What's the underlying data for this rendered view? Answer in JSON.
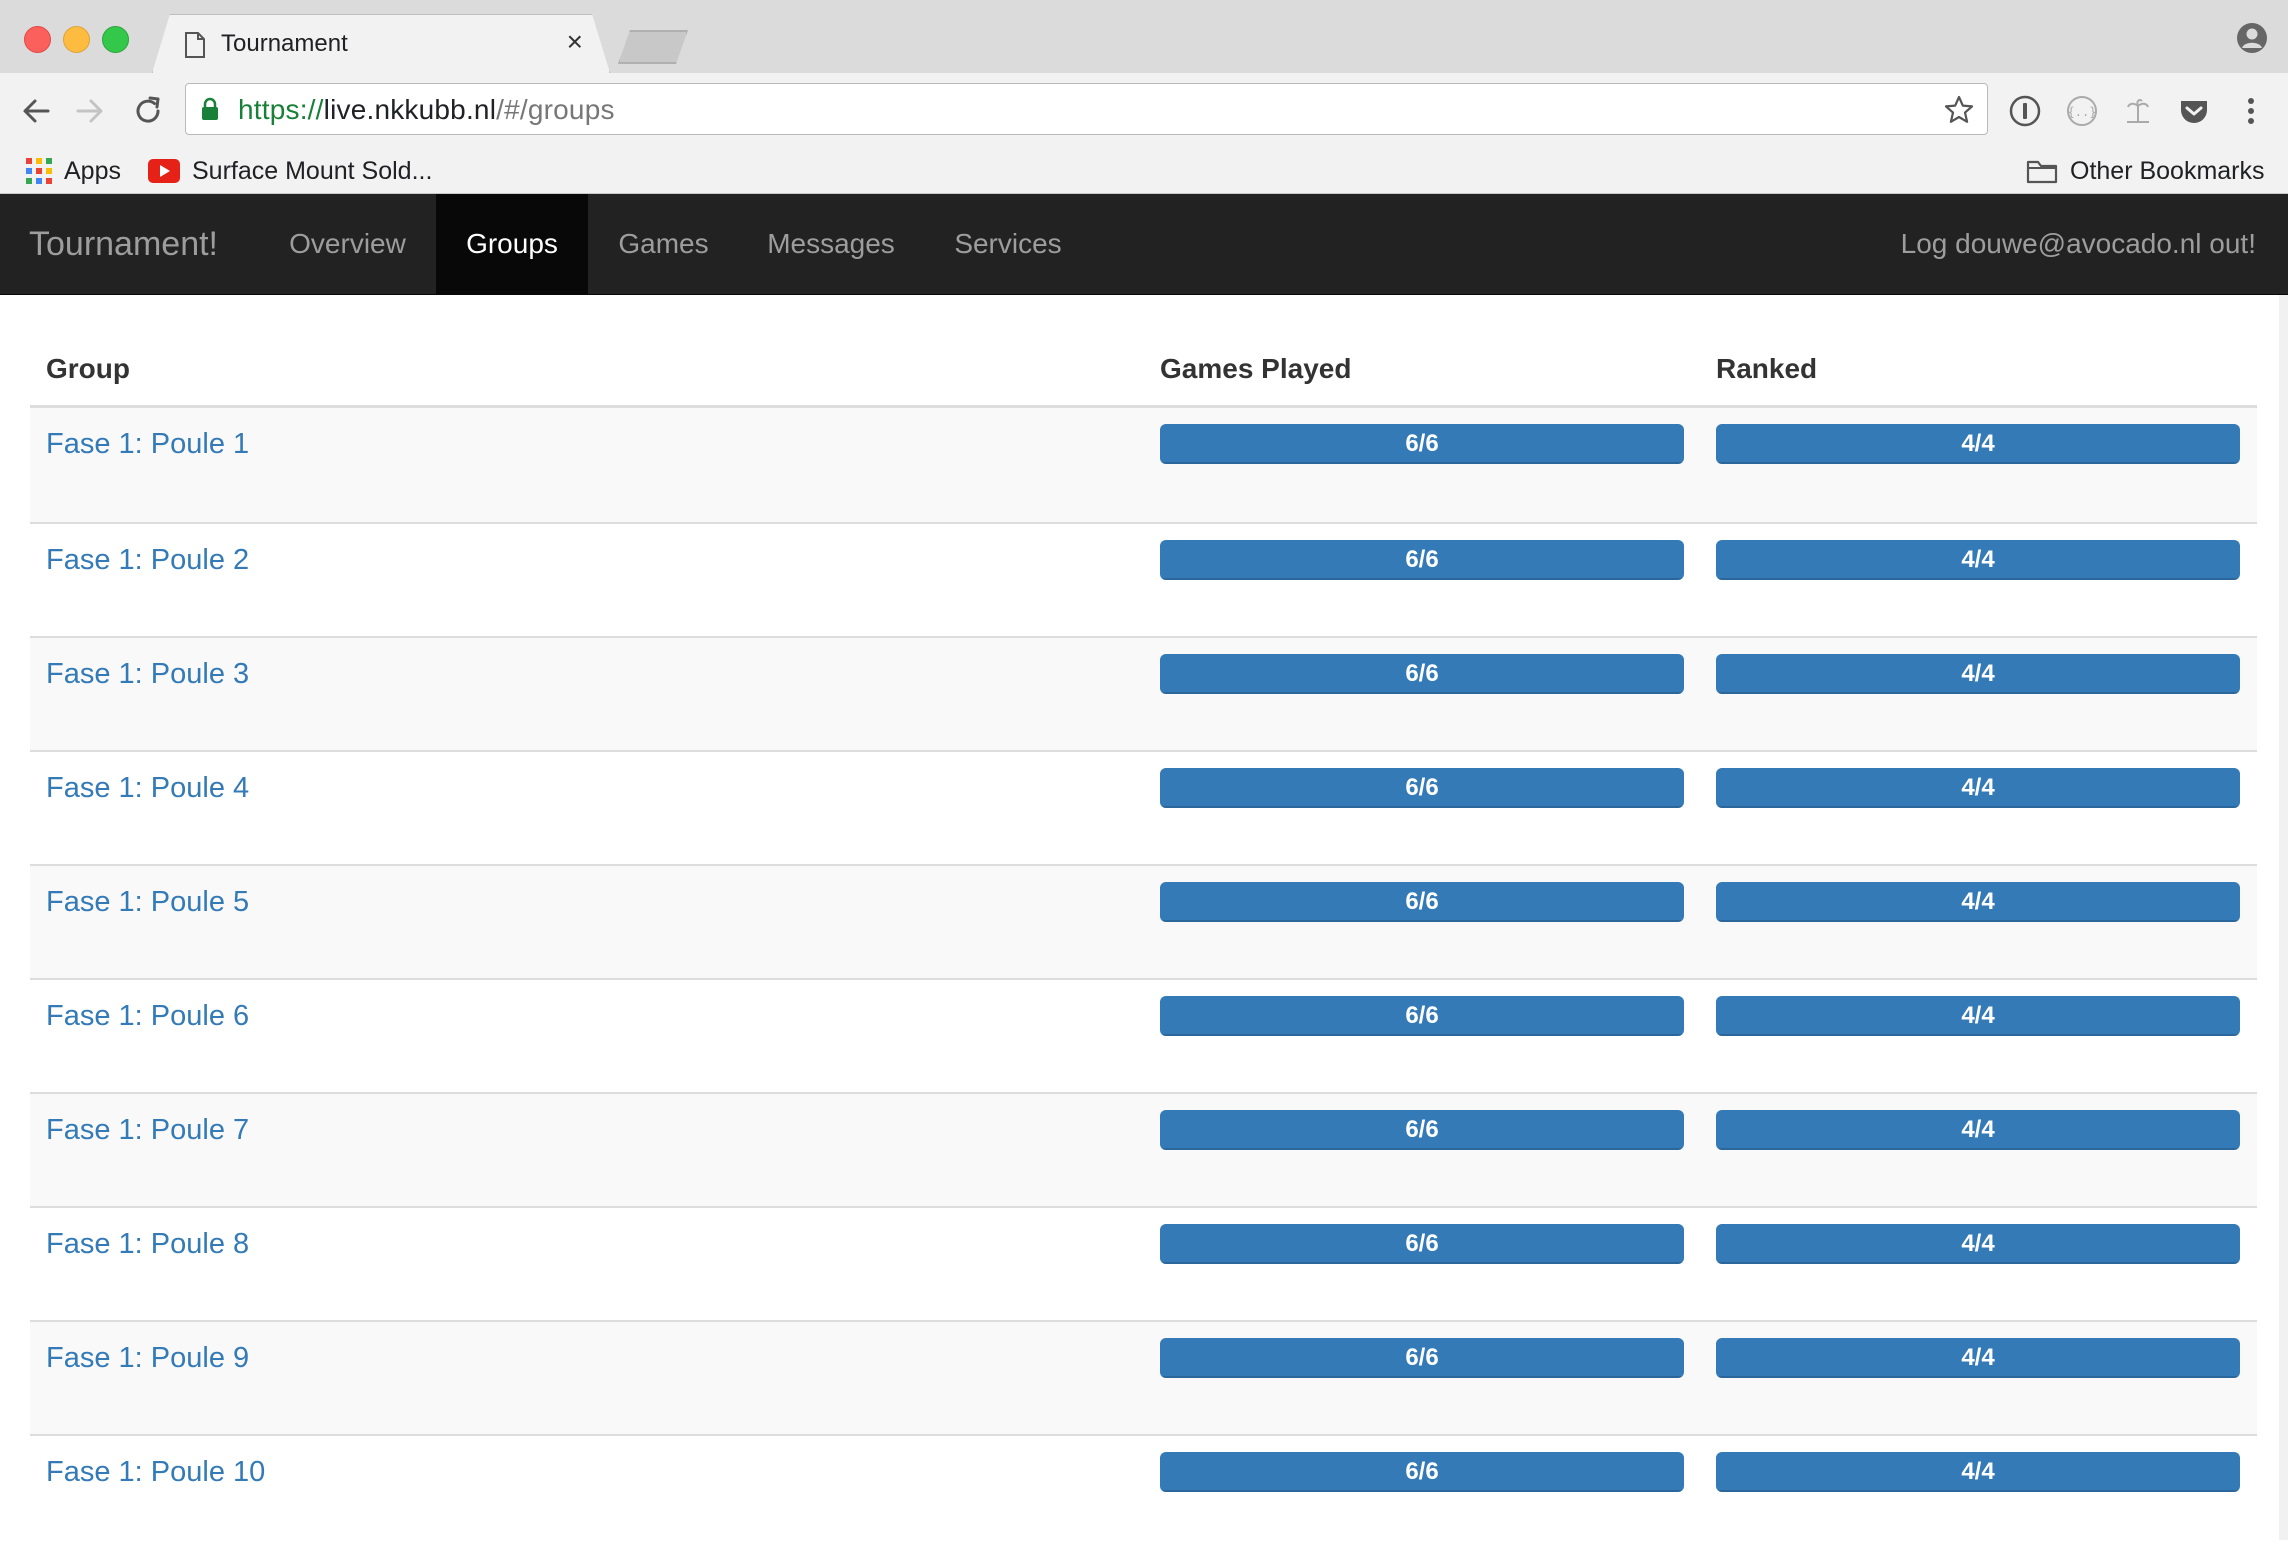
{
  "browser": {
    "tab_title": "Tournament",
    "tab_close": "×",
    "url_scheme": "https://",
    "url_host": "live.nkkubb.nl",
    "url_path": "/#/groups",
    "bookmarks": [
      {
        "label": "Apps",
        "icon": "apps-grid-icon"
      },
      {
        "label": "Surface Mount Sold...",
        "icon": "youtube-icon"
      }
    ],
    "other_bookmarks": "Other Bookmarks"
  },
  "navbar": {
    "brand": "Tournament!",
    "items": [
      {
        "label": "Overview",
        "active": false
      },
      {
        "label": "Groups",
        "active": true
      },
      {
        "label": "Games",
        "active": false
      },
      {
        "label": "Messages",
        "active": false
      },
      {
        "label": "Services",
        "active": false
      }
    ],
    "logout": "Log douwe@avocado.nl out!"
  },
  "table": {
    "headers": {
      "group": "Group",
      "games_played": "Games Played",
      "ranked": "Ranked"
    },
    "rows": [
      {
        "group": "Fase 1: Poule 1",
        "played": "6/6",
        "played_pct": 100,
        "ranked": "4/4",
        "ranked_pct": 100
      },
      {
        "group": "Fase 1: Poule 2",
        "played": "6/6",
        "played_pct": 100,
        "ranked": "4/4",
        "ranked_pct": 100
      },
      {
        "group": "Fase 1: Poule 3",
        "played": "6/6",
        "played_pct": 100,
        "ranked": "4/4",
        "ranked_pct": 100
      },
      {
        "group": "Fase 1: Poule 4",
        "played": "6/6",
        "played_pct": 100,
        "ranked": "4/4",
        "ranked_pct": 100
      },
      {
        "group": "Fase 1: Poule 5",
        "played": "6/6",
        "played_pct": 100,
        "ranked": "4/4",
        "ranked_pct": 100
      },
      {
        "group": "Fase 1: Poule 6",
        "played": "6/6",
        "played_pct": 100,
        "ranked": "4/4",
        "ranked_pct": 100
      },
      {
        "group": "Fase 1: Poule 7",
        "played": "6/6",
        "played_pct": 100,
        "ranked": "4/4",
        "ranked_pct": 100
      },
      {
        "group": "Fase 1: Poule 8",
        "played": "6/6",
        "played_pct": 100,
        "ranked": "4/4",
        "ranked_pct": 100
      },
      {
        "group": "Fase 1: Poule 9",
        "played": "6/6",
        "played_pct": 100,
        "ranked": "4/4",
        "ranked_pct": 100
      },
      {
        "group": "Fase 1: Poule 10",
        "played": "6/6",
        "played_pct": 100,
        "ranked": "4/4",
        "ranked_pct": 100
      }
    ]
  },
  "colors": {
    "navbar_bg": "#222222",
    "navbar_active_bg": "#080808",
    "link": "#337ab7",
    "progress_bar": "#337ab7"
  }
}
